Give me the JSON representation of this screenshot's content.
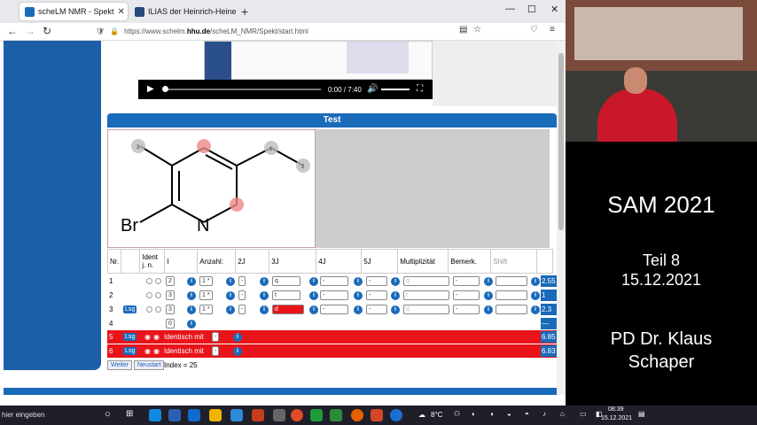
{
  "browser": {
    "tabs": [
      {
        "title": "scheLM NMR - Spekt",
        "active": true
      },
      {
        "title": "ILIAS der Heinrich-Heine-Unive",
        "active": false
      }
    ],
    "new_tab": "+",
    "url_prefix": "https://www.schelm.",
    "url_domain": "hhu.de",
    "url_suffix": "/scheLM_NMR/Spekt/start.html"
  },
  "video": {
    "time": "0:00 / 7:40"
  },
  "section_title": "Test",
  "molecule": {
    "br_label": "Br",
    "n_label": "N",
    "peaks": [
      "3",
      "1",
      "2"
    ]
  },
  "table": {
    "headers": [
      "Nr.",
      "",
      "Ident j. n.",
      "I",
      "Anzahl:",
      "2J",
      "3J",
      "4J",
      "5J",
      "Multiplizität",
      "Bemerk.",
      "Shift"
    ]
  },
  "rows": [
    {
      "nr": "1",
      "i": "2",
      "anzahl": "1 *",
      "j2": "-",
      "j3": "q",
      "j4": "-",
      "j5": "-",
      "mult": "q",
      "bem": "-",
      "shift": "2.55",
      "lsg": false
    },
    {
      "nr": "2",
      "i": "3",
      "anzahl": "1 *",
      "j2": "-",
      "j3": "t",
      "j4": "-",
      "j5": "-",
      "mult": "t",
      "bem": "-",
      "shift": "1",
      "lsg": false
    },
    {
      "nr": "3",
      "i": "3",
      "anzahl": "1 *",
      "j2": "-",
      "j3": "d",
      "j4": "-",
      "j5": "-",
      "mult": "d",
      "bem": "-",
      "shift": "2.3",
      "lsg": true
    },
    {
      "nr": "4",
      "i": "0"
    }
  ],
  "red_rows": [
    {
      "nr": "5",
      "lsg": "Lsg",
      "text": "Identisch mit",
      "sel": "-",
      "shift": "6.85"
    },
    {
      "nr": "6",
      "lsg": "Lsg",
      "text": "Identisch mit",
      "sel": "-",
      "shift": "6.83"
    }
  ],
  "lsg_label": "Lsg",
  "footer": {
    "weiter": "Weiter",
    "neustart": "Neustart",
    "index": "Index = 25"
  },
  "slide": {
    "title": "SAM 2021",
    "subtitle": "Teil 8",
    "date": "15.12.2021",
    "author_line1": "PD Dr. Klaus",
    "author_line2": "Schaper"
  },
  "taskbar": {
    "search": "hier eingeben",
    "weather": "8°C",
    "time": "08:39",
    "date": "15.12.2021"
  },
  "colors": {
    "accent": "#1a6aba",
    "error": "#e8141a"
  }
}
